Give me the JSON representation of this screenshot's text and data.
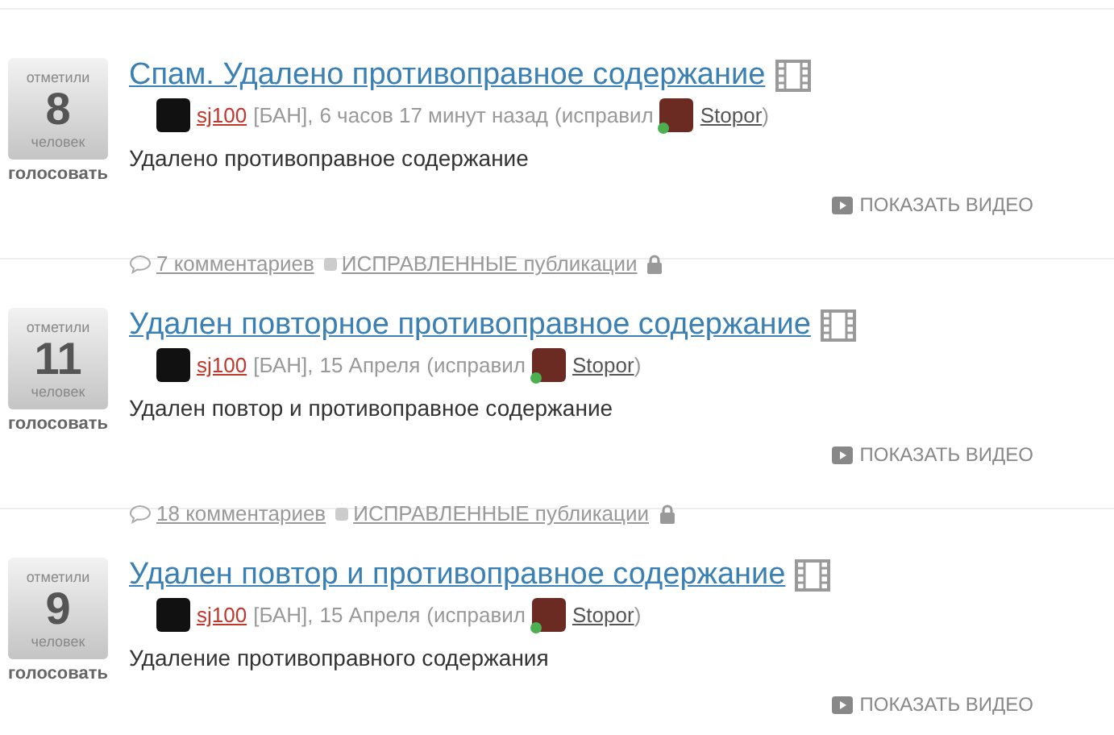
{
  "posts": [
    {
      "votes": {
        "top": "отметили",
        "count": "8",
        "bottom": "человек",
        "action": "голосовать"
      },
      "title": "Спам. Удалено противоправное содержание",
      "has_video": true,
      "meta": {
        "author": "sj100",
        "author_tag": "[БАН],",
        "date": "6 часов 17 минут назад",
        "edited_by": "(исправил",
        "editor": "Stopor",
        "editor_online": true,
        "close": ")"
      },
      "body": "Удалено противоправное содержание",
      "video_button": "ПОКАЗАТЬ ВИДЕО",
      "footer": {
        "comments": "7 комментариев",
        "category": "ИСПРАВЛЕННЫЕ публикации",
        "locked": true
      }
    },
    {
      "votes": {
        "top": "отметили",
        "count": "11",
        "bottom": "человек",
        "action": "голосовать"
      },
      "title": "Удален повторное противоправное содержание",
      "has_video": true,
      "meta": {
        "author": "sj100",
        "author_tag": "[БАН],",
        "date": "15 Апреля",
        "edited_by": "(исправил",
        "editor": "Stopor",
        "editor_online": true,
        "close": ")"
      },
      "body": "Удален повтор и противоправное содержание",
      "video_button": "ПОКАЗАТЬ ВИДЕО",
      "footer": {
        "comments": "18 комментариев",
        "category": "ИСПРАВЛЕННЫЕ публикации",
        "locked": true
      }
    },
    {
      "votes": {
        "top": "отметили",
        "count": "9",
        "bottom": "человек",
        "action": "голосовать"
      },
      "title": "Удален повтор и противоправное содержание",
      "has_video": true,
      "meta": {
        "author": "sj100",
        "author_tag": "[БАН],",
        "date": "15 Апреля",
        "edited_by": "(исправил",
        "editor": "Stopor",
        "editor_online": true,
        "close": ")"
      },
      "body": "Удаление противоправного содержания",
      "video_button": "ПОКАЗАТЬ ВИДЕО"
    }
  ]
}
